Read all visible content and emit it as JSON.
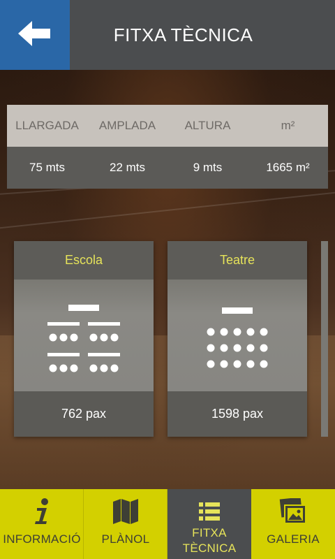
{
  "header": {
    "title": "FITXA TÈCNICA",
    "back_icon": "arrow-left-icon"
  },
  "stats": {
    "headers": [
      "LLARGADA",
      "AMPLADA",
      "ALTURA",
      "m²"
    ],
    "values": [
      "75 mts",
      "22 mts",
      "9 mts",
      "1665 m²"
    ]
  },
  "layouts": [
    {
      "name": "Escola",
      "capacity": "762 pax",
      "icon": "classroom-layout-icon"
    },
    {
      "name": "Teatre",
      "capacity": "1598 pax",
      "icon": "theatre-layout-icon"
    }
  ],
  "nav": {
    "items": [
      {
        "label": "INFORMACIÓ",
        "icon": "info-icon"
      },
      {
        "label": "PLÀNOL",
        "icon": "map-icon"
      },
      {
        "label_line1": "FITXA",
        "label_line2": "TÈCNICA",
        "icon": "list-icon",
        "active": true
      },
      {
        "label": "GALERIA",
        "icon": "gallery-icon"
      }
    ]
  },
  "colors": {
    "header_bg": "#4b4d4f",
    "back_bg": "#2a67a7",
    "accent_yellow": "#d3d000",
    "card_title": "#e6e35a"
  }
}
